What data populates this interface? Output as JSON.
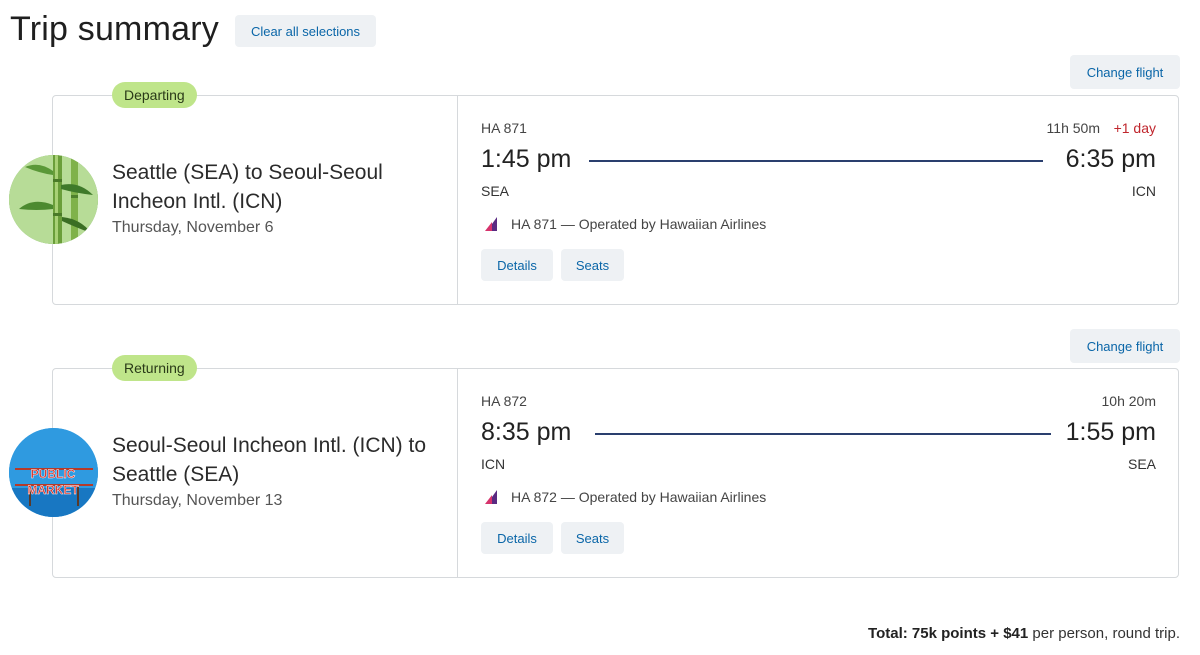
{
  "header": {
    "title": "Trip summary",
    "clear_label": "Clear all selections"
  },
  "departing": {
    "change_label": "Change flight",
    "badge": "Departing",
    "route": "Seattle (SEA) to Seoul-Seoul Incheon Intl. (ICN)",
    "date": "Thursday, November 6",
    "flight_number": "HA 871",
    "duration": "11h 50m",
    "plus_day": "+1 day",
    "depart_time": "1:45 pm",
    "arrive_time": "6:35 pm",
    "origin": "SEA",
    "destination": "ICN",
    "operated_by": "HA 871 — Operated by Hawaiian Airlines",
    "details_label": "Details",
    "seats_label": "Seats"
  },
  "returning": {
    "change_label": "Change flight",
    "badge": "Returning",
    "route": "Seoul-Seoul Incheon Intl. (ICN) to Seattle (SEA)",
    "date": "Thursday, November 13",
    "flight_number": "HA 872",
    "duration": "10h 20m",
    "depart_time": "8:35 pm",
    "arrive_time": "1:55 pm",
    "origin": "ICN",
    "destination": "SEA",
    "operated_by": "HA 872 — Operated by Hawaiian Airlines",
    "details_label": "Details",
    "seats_label": "Seats",
    "photo_text": [
      "PUBLIC",
      "MARKET"
    ]
  },
  "footer": {
    "total_bold": "Total: 75k points + $41",
    "total_rest": " per person, round trip."
  },
  "colors": {
    "accent_link": "#0a66a8",
    "badge_bg": "#bfe58a",
    "plus_day": "#c0262d",
    "route_line": "#2a3f6e"
  },
  "icons": {
    "departing_photo": "bamboo-photo",
    "returning_photo": "public-market-photo",
    "airline_logo": "hawaiian-airlines-icon"
  }
}
